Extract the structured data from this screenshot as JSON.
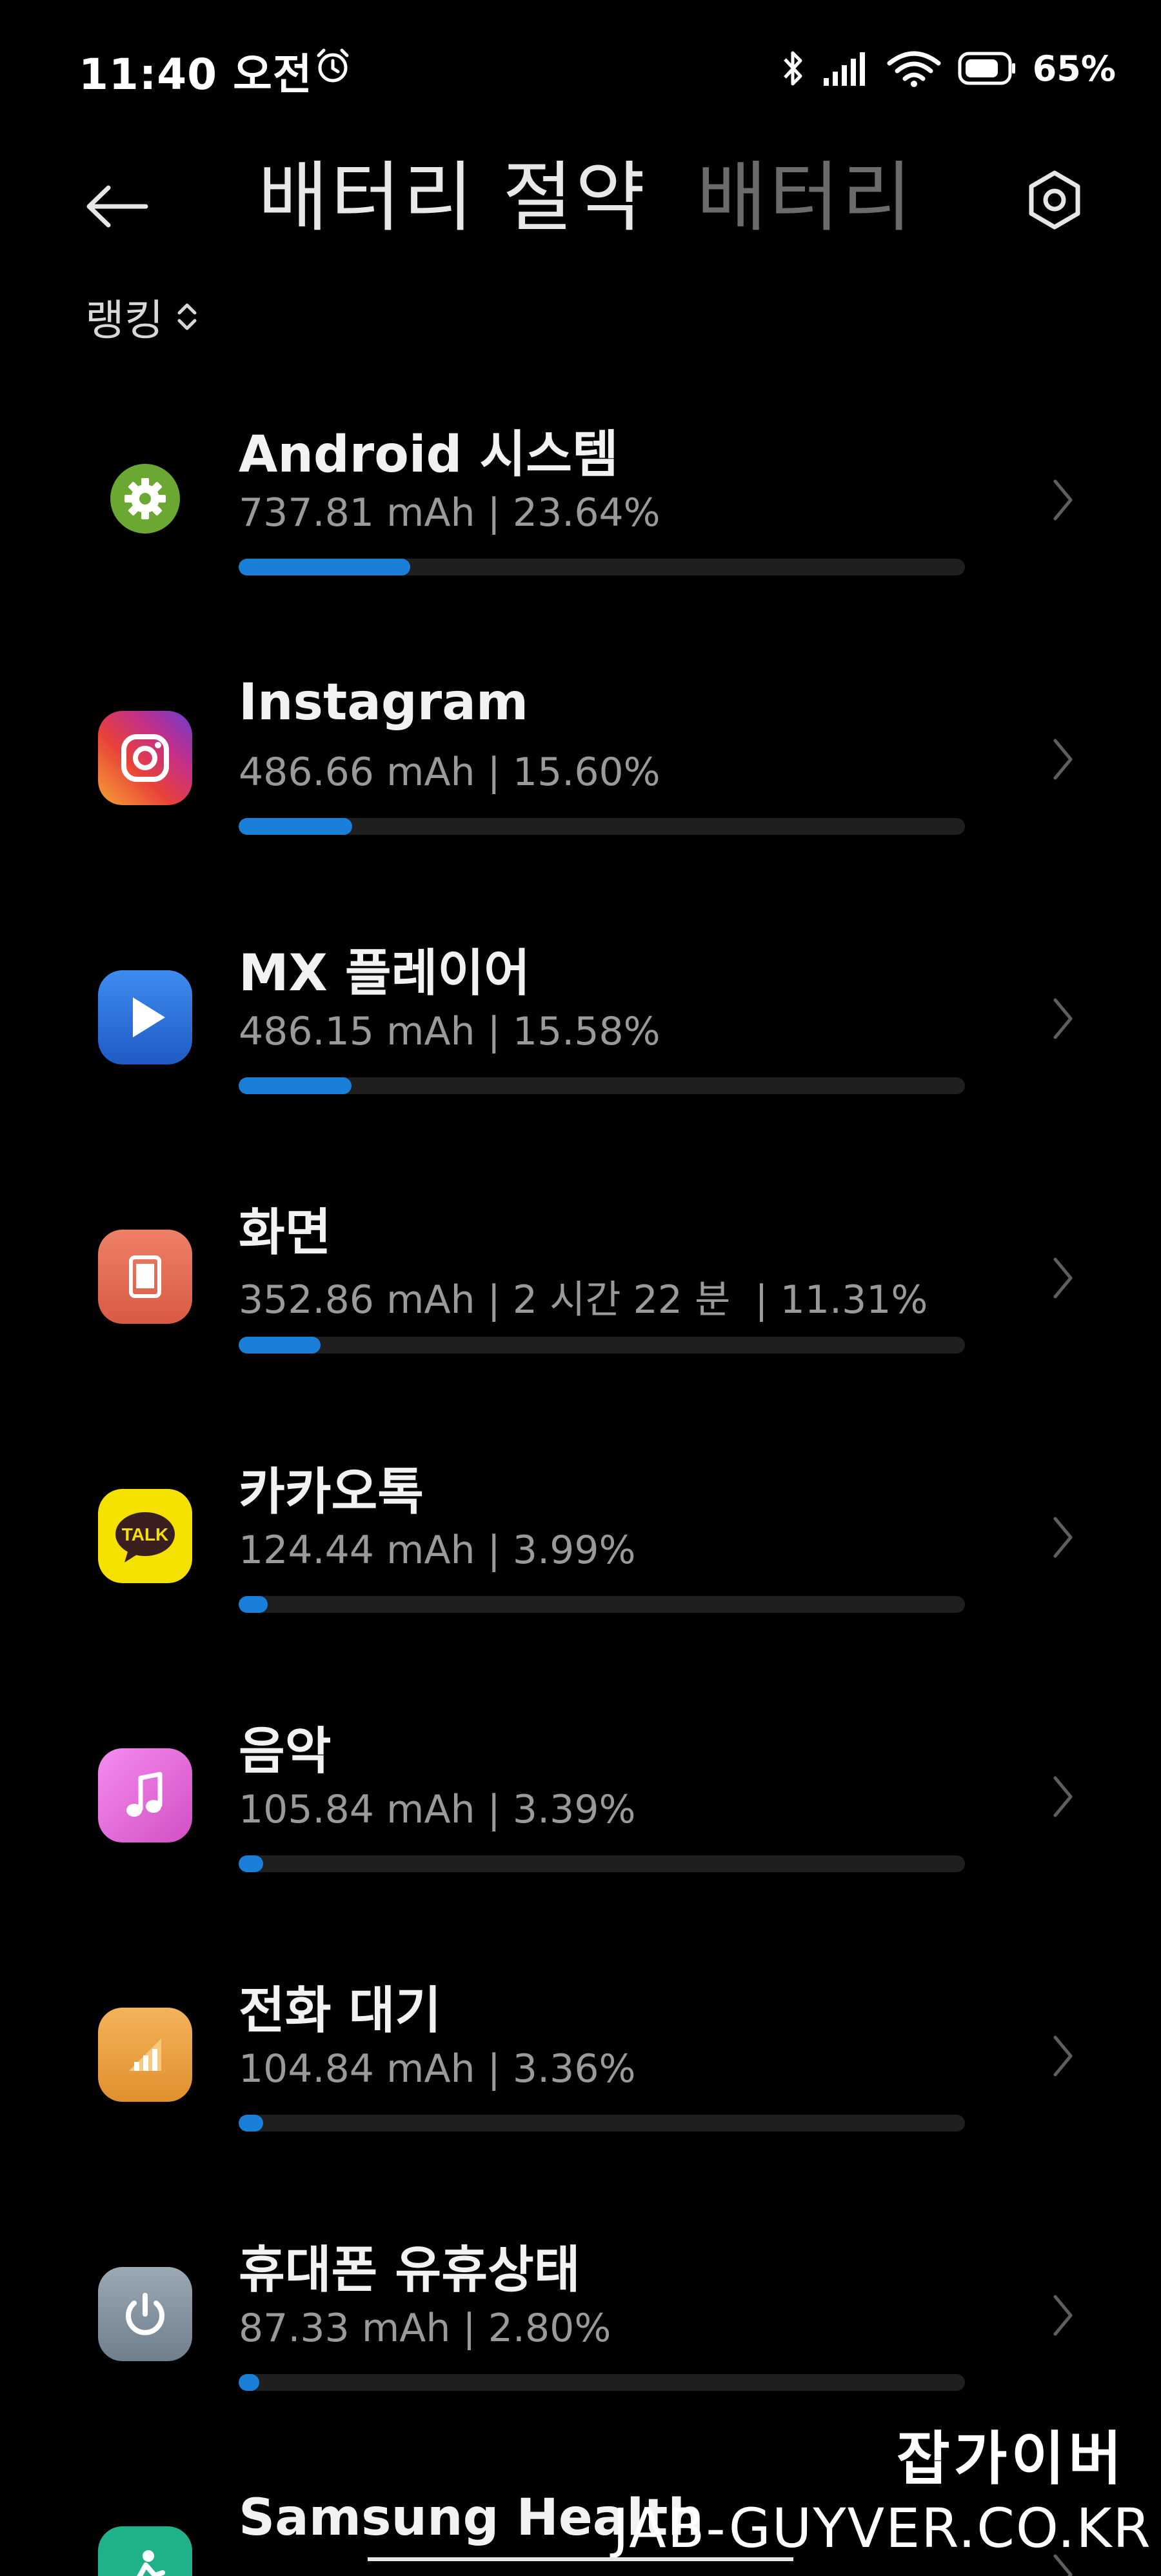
{
  "status_bar": {
    "time": "11:40 오전",
    "battery_percent": "65%",
    "icons": [
      "alarm-icon",
      "bluetooth-icon",
      "signal-icon",
      "wifi-icon",
      "battery-icon"
    ]
  },
  "header": {
    "tabs": [
      {
        "label": "배터리 절약",
        "active": true
      },
      {
        "label": "배터리",
        "active": false
      }
    ],
    "back_icon": "arrow-left-icon",
    "settings_icon": "hexagon-settings-icon"
  },
  "sort": {
    "label": "랭킹"
  },
  "colors": {
    "background": "#000000",
    "usage_bar": "#1a7fd8",
    "usage_track": "#1f1f1f",
    "inactive_tab": "#6b6b6b"
  },
  "apps": [
    {
      "name": "Android 시스템",
      "usage": "737.81 mAh | 23.64%",
      "percent": 23.64,
      "icon": "android-system-gear-icon"
    },
    {
      "name": "Instagram",
      "usage": "486.66 mAh | 15.60%",
      "percent": 15.6,
      "icon": "instagram-icon"
    },
    {
      "name": "MX 플레이어",
      "usage": "486.15 mAh | 15.58%",
      "percent": 15.58,
      "icon": "mx-player-icon"
    },
    {
      "name": "화면",
      "usage": "352.86 mAh | 2 시간 22 분  | 11.31%",
      "percent": 11.31,
      "icon": "screen-icon"
    },
    {
      "name": "카카오톡",
      "usage": "124.44 mAh | 3.99%",
      "percent": 3.99,
      "icon": "kakaotalk-icon",
      "icon_text": "TALK"
    },
    {
      "name": "음악",
      "usage": "105.84 mAh | 3.39%",
      "percent": 3.39,
      "icon": "music-icon"
    },
    {
      "name": "전화 대기",
      "usage": "104.84 mAh | 3.36%",
      "percent": 3.36,
      "icon": "cell-standby-icon"
    },
    {
      "name": "휴대폰 유휴상태",
      "usage": "87.33 mAh | 2.80%",
      "percent": 2.8,
      "icon": "phone-idle-power-icon"
    },
    {
      "name": "Samsung Health",
      "usage": "",
      "percent": 0,
      "icon": "samsung-health-icon"
    }
  ],
  "watermark": {
    "line1": "잡가이버",
    "line2": "JAB-GUYVER.CO.KR"
  }
}
